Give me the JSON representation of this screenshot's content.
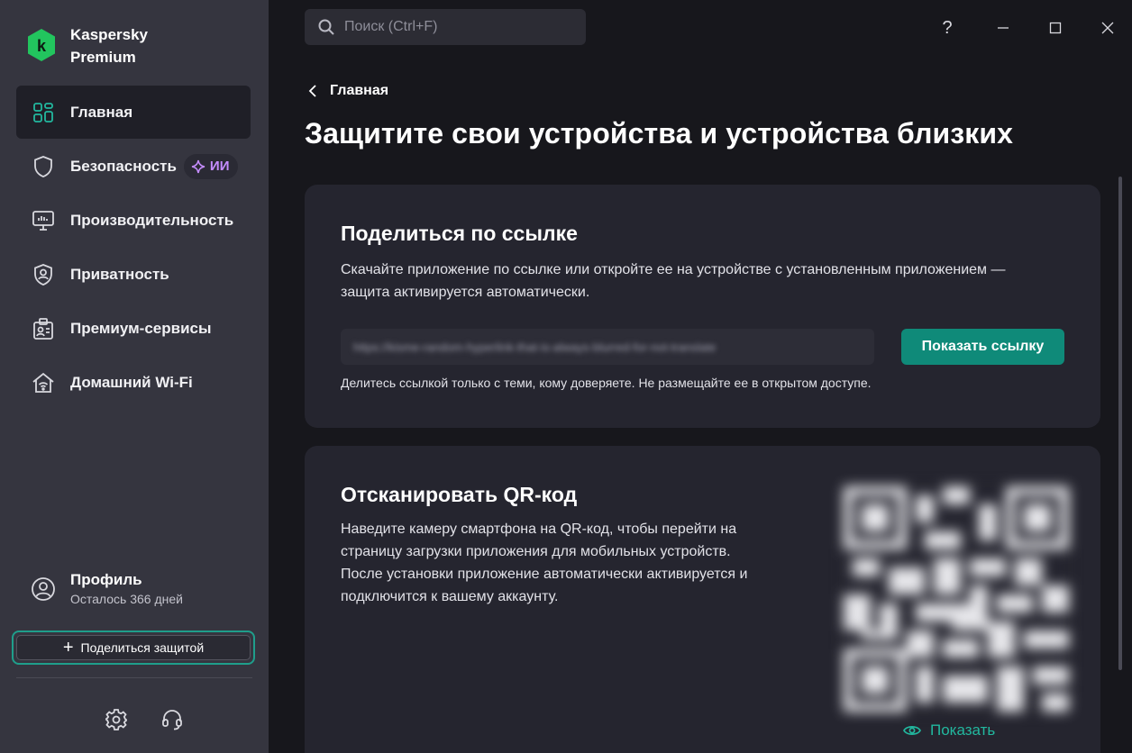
{
  "app": {
    "name_line1": "Kaspersky",
    "name_line2": "Premium",
    "logo_letter": "k"
  },
  "sidebar": {
    "items": [
      {
        "label": "Главная",
        "icon": "grid-icon",
        "active": true
      },
      {
        "label": "Безопасность",
        "icon": "shield-icon",
        "badge": "ИИ"
      },
      {
        "label": "Производительность",
        "icon": "monitor-icon"
      },
      {
        "label": "Приватность",
        "icon": "privacy-shield-icon"
      },
      {
        "label": "Премиум-сервисы",
        "icon": "id-badge-icon"
      },
      {
        "label": "Домашний Wi-Fi",
        "icon": "home-wifi-icon"
      }
    ],
    "profile": {
      "name": "Профиль",
      "subtitle": "Осталось 366 дней"
    },
    "share_button": "Поделиться защитой"
  },
  "header": {
    "search_placeholder": "Поиск (Ctrl+F)",
    "help": "?"
  },
  "main": {
    "back_label": "Главная",
    "title": "Защитите свои устройства и устройства близких",
    "share_card": {
      "title": "Поделиться по ссылке",
      "description_line1": "Скачайте приложение по ссылке или откройте ее на устройстве с установленным приложением —",
      "description_line2": "защита активируется автоматически.",
      "blurred_link": "https://kisme-random-hyperlink-that-is-always-blurred-for-not-translate",
      "show_link_button": "Показать ссылку",
      "hint": "Делитесь ссылкой только с теми, кому доверяете. Не размещайте ее в открытом доступе."
    },
    "qr_card": {
      "title": "Отсканировать QR-код",
      "description_lines": [
        "Наведите камеру смартфона на QR-код, чтобы перейти на",
        "страницу загрузки приложения для мобильных устройств.",
        "После установки приложение автоматически активируется и",
        "подключится к вашему аккаунту."
      ],
      "show_button": "Показать"
    }
  },
  "colors": {
    "accent": "#0f8a79",
    "accent_text": "#22b89f",
    "ai_badge": "#c58dff",
    "sidebar_bg": "#35353f",
    "main_bg": "#17171c",
    "card_bg": "#25252f"
  }
}
